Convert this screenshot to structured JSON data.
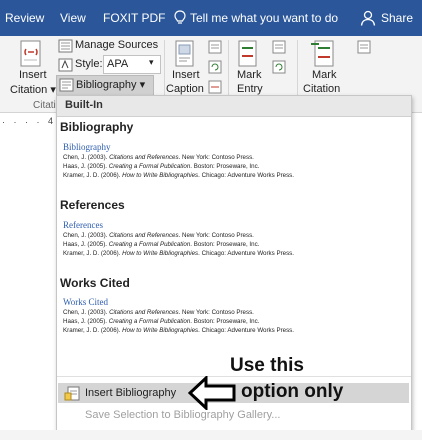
{
  "titlebar": {
    "tabs": [
      "Review",
      "View",
      "FOXIT PDF"
    ],
    "tell_me": "Tell me what you want to do",
    "share": "Share",
    "bg_color": "#2b579a"
  },
  "ribbon": {
    "insert_citation": [
      "Insert",
      "Citation ▾"
    ],
    "manage_sources": "Manage Sources",
    "style_label": "Style:",
    "style_value": "APA",
    "bibliography": "Bibliography ▾",
    "group_citations": "Citati",
    "insert_caption": [
      "Insert",
      "Caption"
    ],
    "mark_entry": [
      "Mark",
      "Entry"
    ],
    "mark_citation": [
      "Mark",
      "Citation"
    ]
  },
  "ruler": {
    "marker": "4"
  },
  "dropdown": {
    "header": "Built-In",
    "sections": [
      {
        "title": "Bibliography",
        "link": "Bibliography",
        "entries": [
          [
            "Chen, J. (2003). ",
            "Citations and References",
            ". New York: Contoso Press."
          ],
          [
            "Haas, J. (2005). ",
            "Creating a Formal Publication",
            ". Boston: Proseware, Inc."
          ],
          [
            "Kramer, J. D. (2006). ",
            "How to Write Bibliographies",
            ". Chicago: Adventure Works Press."
          ]
        ]
      },
      {
        "title": "References",
        "link": "References",
        "entries": [
          [
            "Chen, J. (2003). ",
            "Citations and References",
            ". New York: Contoso Press."
          ],
          [
            "Haas, J. (2005). ",
            "Creating a Formal Publication",
            ". Boston: Proseware, Inc."
          ],
          [
            "Kramer, J. D. (2006). ",
            "How to Write Bibliographies",
            ". Chicago: Adventure Works Press."
          ]
        ]
      },
      {
        "title": "Works Cited",
        "link": "Works Cited",
        "entries": [
          [
            "Chen, J. (2003). ",
            "Citations and References",
            ". New York: Contoso Press."
          ],
          [
            "Haas, J. (2005). ",
            "Creating a Formal Publication",
            ". Boston: Proseware, Inc."
          ],
          [
            "Kramer, J. D. (2006). ",
            "How to Write Bibliographies",
            ". Chicago: Adventure Works Press."
          ]
        ]
      }
    ],
    "insert_bibliography": "Insert Bibliography",
    "save_selection": "Save Selection to Bibliography Gallery..."
  },
  "annotation": {
    "line1": "Use this",
    "line2": "option only"
  }
}
